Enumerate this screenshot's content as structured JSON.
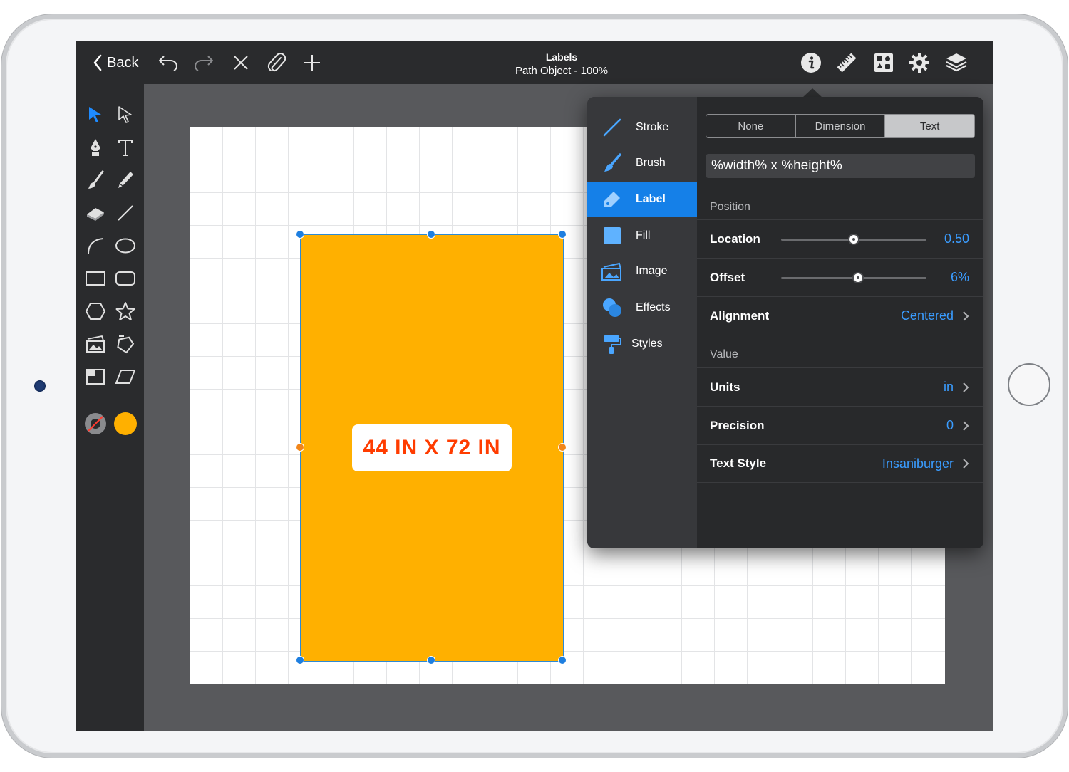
{
  "toolbar": {
    "back_label": "Back",
    "title": "Labels",
    "subtitle": "Path Object - 100%",
    "icons": [
      "undo-icon",
      "redo-icon",
      "close-icon",
      "attach-icon",
      "add-icon",
      "info-icon",
      "ruler-icon",
      "grid-icon",
      "gear-icon",
      "layers-icon"
    ]
  },
  "tools": [
    "select",
    "direct-select",
    "pen",
    "text",
    "brush",
    "pencil",
    "eraser",
    "line",
    "arc",
    "ellipse",
    "rectangle",
    "rounded-rectangle",
    "hexagon",
    "star",
    "image-frame",
    "rotate",
    "frame",
    "parallelogram",
    "stroke-color",
    "fill-color"
  ],
  "canvas": {
    "label_text": "44 IN X 72 IN",
    "shape_color": "#ffb000",
    "label_color": "#ff3c00"
  },
  "inspector": {
    "categories": [
      {
        "label": "Stroke",
        "icon": "stroke-icon"
      },
      {
        "label": "Brush",
        "icon": "brush-icon"
      },
      {
        "label": "Label",
        "icon": "label-icon",
        "selected": true
      },
      {
        "label": "Fill",
        "icon": "fill-icon"
      },
      {
        "label": "Image",
        "icon": "image-icon"
      },
      {
        "label": "Effects",
        "icon": "effects-icon"
      },
      {
        "label": "Styles",
        "icon": "styles-icon"
      }
    ],
    "segments": [
      "None",
      "Dimension",
      "Text"
    ],
    "selected_segment": "Text",
    "text_field": "%width% x %height%",
    "position_header": "Position",
    "location": {
      "label": "Location",
      "value": "0.50",
      "fraction": 0.5
    },
    "offset": {
      "label": "Offset",
      "value": "6%",
      "fraction": 0.53
    },
    "alignment": {
      "label": "Alignment",
      "value": "Centered"
    },
    "value_header": "Value",
    "units": {
      "label": "Units",
      "value": "in"
    },
    "precision": {
      "label": "Precision",
      "value": "0"
    },
    "text_style": {
      "label": "Text Style",
      "value": "Insaniburger"
    },
    "accent_color": "#1580e8"
  }
}
